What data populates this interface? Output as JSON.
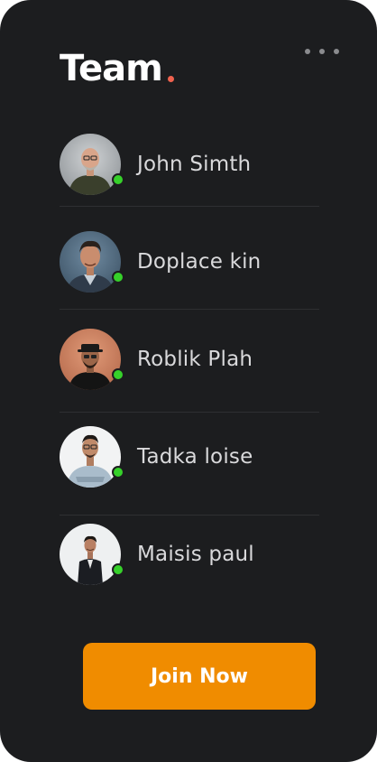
{
  "header": {
    "title": "Team",
    "title_dot_color": "#f0624e",
    "menu_icon": "more-horizontal-icon"
  },
  "members": [
    {
      "name": "John Simth",
      "status": "online"
    },
    {
      "name": "Doplace kin",
      "status": "online"
    },
    {
      "name": "Roblik Plah",
      "status": "online"
    },
    {
      "name": "Tadka loise",
      "status": "online"
    },
    {
      "name": "Maisis paul",
      "status": "online"
    }
  ],
  "status_color": "#36d12a",
  "cta": {
    "label": "Join Now",
    "color": "#f08c00"
  },
  "colors": {
    "card_background": "#1c1d1f",
    "name_text": "#d9d9db"
  }
}
